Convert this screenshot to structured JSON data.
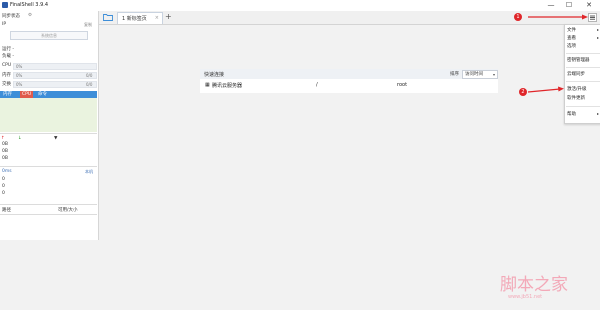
{
  "window": {
    "title": "FinalShell 3.9.4",
    "controls": {
      "minimize": "—",
      "maximize": "☐",
      "close": "✕"
    }
  },
  "sidebar": {
    "sync_status": "同步状态",
    "ip_label": "IP",
    "ip_copy": "复制",
    "system_info_button": "系统信息",
    "uptime_label": "运行 -",
    "load_label": "负载 -",
    "cpu_label": "CPU",
    "cpu_value": "0%",
    "mem_label": "内存",
    "mem_value": "0%",
    "mem_extra": "0/0",
    "swap_label": "交换",
    "swap_value": "0%",
    "swap_extra": "0/0",
    "proc_tabs": [
      "内存",
      "CPU",
      "命令"
    ],
    "net_values": [
      "0B",
      "0B",
      "0B"
    ],
    "net_legend_up": "↑",
    "net_legend_down": "↓",
    "latency_label": "0ms",
    "latency_target": "本机",
    "latency_values": [
      "0",
      "0",
      "0"
    ],
    "disk_col_path": "路径",
    "disk_col_size": "可用/大小"
  },
  "tabs": {
    "session_label": "1 新标签页",
    "close": "×",
    "add": "+"
  },
  "quick_connect": {
    "title": "快速连接",
    "sort_label": "排序",
    "sort_value": "访问时间",
    "rows": [
      {
        "name": "腾讯云服务器",
        "path": "/",
        "user": "root"
      }
    ]
  },
  "menu": {
    "items": [
      {
        "label": "文件",
        "submenu": true
      },
      {
        "label": "查看",
        "submenu": true
      },
      {
        "label": "选项",
        "submenu": false
      },
      {
        "label": "密钥管理器",
        "submenu": false
      },
      {
        "label": "云端同步",
        "submenu": false
      },
      {
        "label": "激活/升级",
        "submenu": false
      },
      {
        "label": "软件更新",
        "submenu": false
      },
      {
        "label": "帮助",
        "submenu": true
      }
    ]
  },
  "annotations": {
    "one": "1",
    "two": "2",
    "color": "#e0262a"
  },
  "watermark": {
    "text": "脚本之家",
    "url": "www.jb51.net"
  },
  "colors": {
    "accent": "#3d8ed8",
    "active_tab": "#e05a4c",
    "proc_area": "#eaf3df"
  }
}
